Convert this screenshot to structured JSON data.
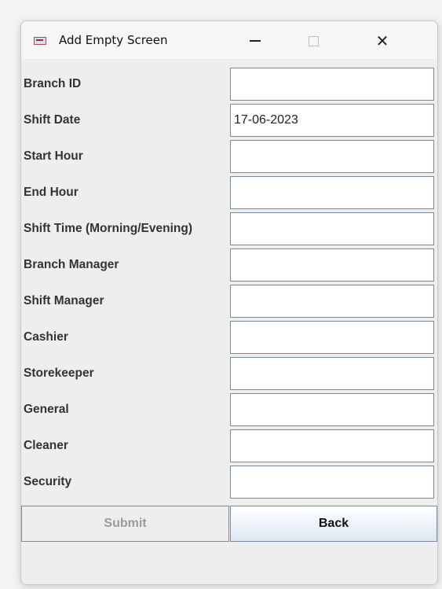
{
  "window": {
    "title": "Add Empty Screen",
    "icon": "java-app-icon",
    "controls": {
      "minimize": "minimize-icon",
      "maximize": "maximize-icon",
      "close": "close-icon",
      "close_glyph": "✕"
    }
  },
  "form": {
    "fields": [
      {
        "label": "Branch ID",
        "value": ""
      },
      {
        "label": "Shift Date",
        "value": "17-06-2023"
      },
      {
        "label": "Start Hour",
        "value": ""
      },
      {
        "label": "End Hour",
        "value": ""
      },
      {
        "label": "Shift Time (Morning/Evening)",
        "value": ""
      },
      {
        "label": "Branch Manager",
        "value": ""
      },
      {
        "label": "Shift Manager",
        "value": ""
      },
      {
        "label": "Cashier",
        "value": ""
      },
      {
        "label": "Storekeeper",
        "value": ""
      },
      {
        "label": "General",
        "value": ""
      },
      {
        "label": "Cleaner",
        "value": ""
      },
      {
        "label": "Security",
        "value": ""
      }
    ]
  },
  "buttons": {
    "submit": "Submit",
    "back": "Back"
  },
  "colors": {
    "window_bg": "#eeeeee",
    "label_text": "#333333",
    "disabled_text": "#9a9a9a"
  }
}
